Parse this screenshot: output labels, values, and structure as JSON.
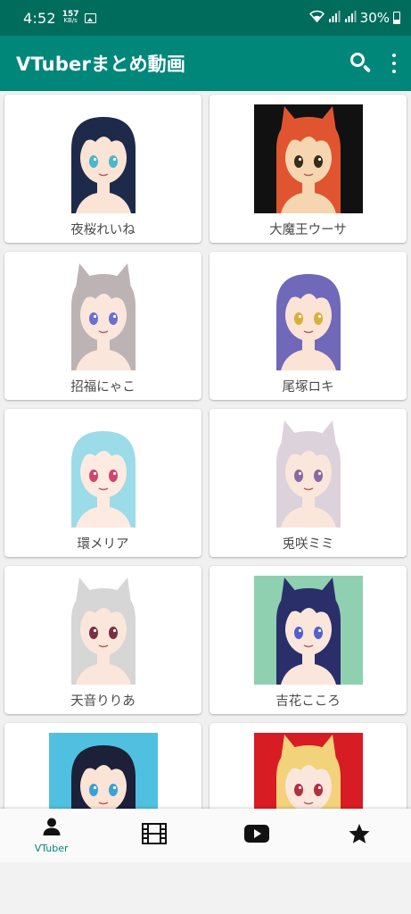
{
  "status_bar": {
    "time": "4:52",
    "net_speed_value": "157",
    "net_speed_unit": "KB/s",
    "battery": "30%"
  },
  "app_bar": {
    "title": "VTuberまとめ動画",
    "actions": [
      "search-icon",
      "more-vert-icon"
    ]
  },
  "vtubers": [
    {
      "name": "夜桜れいね",
      "hair": "#1e2a4a",
      "skin": "#fbe3d6",
      "eye": "#4bb7c9",
      "bg": "#ffffff",
      "ears": false
    },
    {
      "name": "大魔王ウーサ",
      "hair": "#e0552f",
      "skin": "#f5d6b0",
      "eye": "#3a2a1a",
      "bg": "#111111",
      "ears": true
    },
    {
      "name": "招福にゃこ",
      "hair": "#bcb4b4",
      "skin": "#fbe6dc",
      "eye": "#6a6fd1",
      "bg": "#ffffff",
      "ears": true
    },
    {
      "name": "尾塚ロキ",
      "hair": "#7068b8",
      "skin": "#fbe3d6",
      "eye": "#d8b13b",
      "bg": "#ffffff",
      "ears": false
    },
    {
      "name": "環メリア",
      "hair": "#9cdbe8",
      "skin": "#fdeae0",
      "eye": "#d0456e",
      "bg": "#ffffff",
      "ears": false
    },
    {
      "name": "兎咲ミミ",
      "hair": "#dcd2dc",
      "skin": "#fbe6dc",
      "eye": "#8a6aa0",
      "bg": "#ffffff",
      "ears": true
    },
    {
      "name": "天音りりあ",
      "hair": "#d6d6d6",
      "skin": "#fbe6dc",
      "eye": "#7a3040",
      "bg": "#ffffff",
      "ears": true
    },
    {
      "name": "吉花こころ",
      "hair": "#2a2f6a",
      "skin": "#fbe6dc",
      "eye": "#5060d0",
      "bg": "#8fd0b0",
      "ears": true
    },
    {
      "name": "",
      "hair": "#1c2038",
      "skin": "#fbe3d6",
      "eye": "#3aa0d8",
      "bg": "#4fc0e0",
      "ears": false
    },
    {
      "name": "",
      "hair": "#f2d27a",
      "skin": "#fbe6dc",
      "eye": "#b03040",
      "bg": "#d81c24",
      "ears": true
    }
  ],
  "bottom_nav": {
    "items": [
      {
        "icon": "person-icon",
        "label": "VTuber",
        "active": true
      },
      {
        "icon": "film-icon",
        "label": "",
        "active": false
      },
      {
        "icon": "youtube-icon",
        "label": "",
        "active": false
      },
      {
        "icon": "star-icon",
        "label": "",
        "active": false
      }
    ]
  },
  "colors": {
    "status_bar": "#006c5c",
    "app_bar": "#00877a",
    "accent": "#00877a"
  }
}
